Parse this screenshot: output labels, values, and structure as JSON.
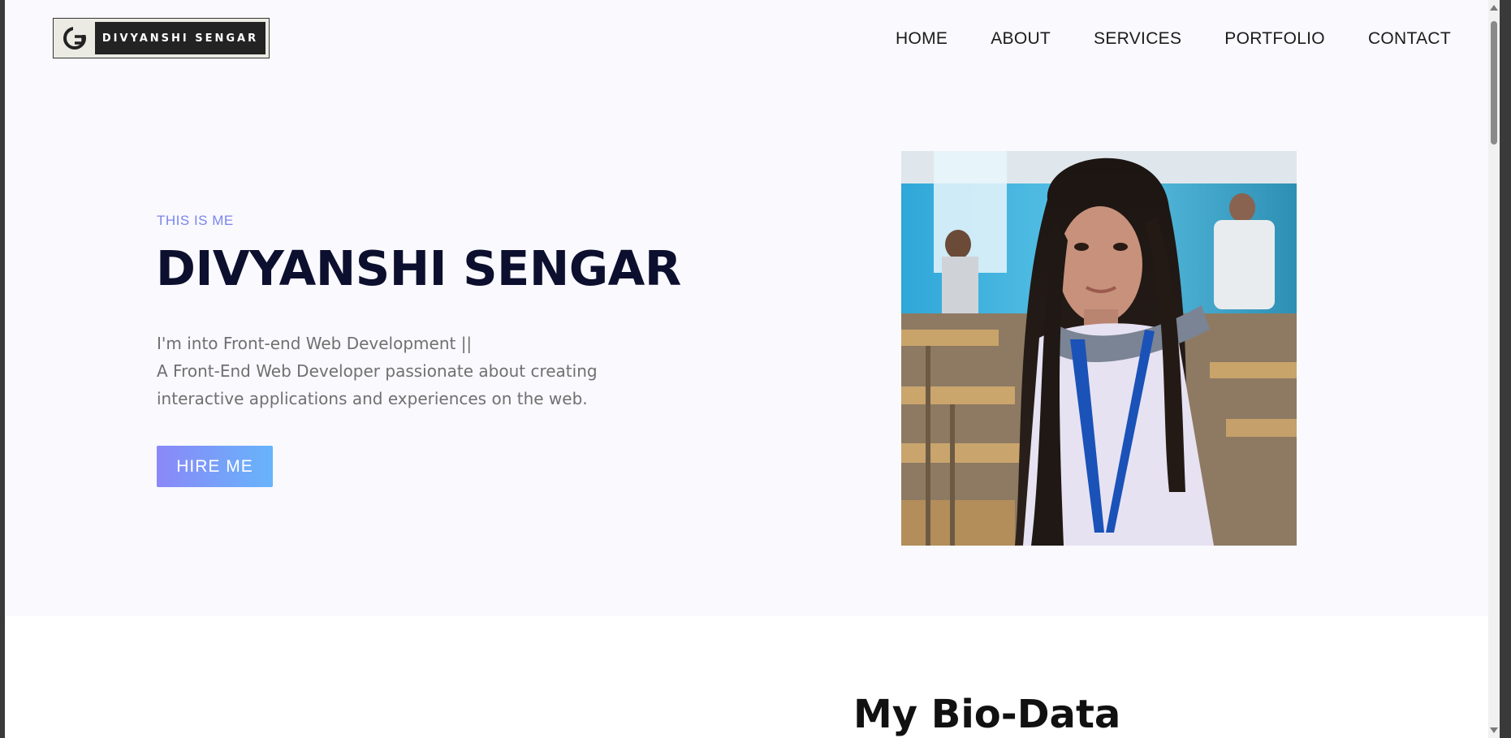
{
  "header": {
    "logo_text": "DIVYANSHI SENGAR",
    "logo_mark_icon": "circular-g-logo-icon"
  },
  "nav": {
    "items": [
      {
        "label": "HOME"
      },
      {
        "label": "ABOUT"
      },
      {
        "label": "SERVICES"
      },
      {
        "label": "PORTFOLIO"
      },
      {
        "label": "CONTACT"
      }
    ]
  },
  "hero": {
    "eyebrow": "THIS IS ME",
    "name": "DIVYANSHI SENGAR",
    "description_lines": [
      "I'm into Front-end Web Development ||",
      "A Front-End Web Developer passionate about creating",
      "interactive applications and experiences on the web."
    ],
    "cta_label": "HIRE ME",
    "photo_alt": "Portrait photo"
  },
  "bio_section": {
    "title": "My Bio-Data"
  },
  "colors": {
    "page_bg": "#f9f9fe",
    "accent_text": "#7a86ec",
    "heading": "#0c0f2e",
    "button_gradient_start": "#8a88f7",
    "button_gradient_end": "#67b4fb"
  }
}
